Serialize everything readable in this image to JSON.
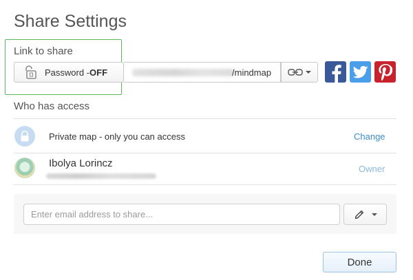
{
  "dialog": {
    "title": "Share Settings"
  },
  "link_section": {
    "label": "Link to share",
    "password_button": {
      "label": "Password - ",
      "state": "OFF"
    },
    "url_suffix": "/mindmap",
    "link_options_icon": "chain-link-icon"
  },
  "social": [
    {
      "name": "facebook",
      "icon": "facebook-icon",
      "color": "#3b5998"
    },
    {
      "name": "twitter",
      "icon": "twitter-icon",
      "color": "#4a9fe8"
    },
    {
      "name": "pinterest",
      "icon": "pinterest-icon",
      "color": "#c8232c"
    }
  ],
  "access_section": {
    "label": "Who has access",
    "rows": [
      {
        "icon": "lock-icon",
        "text": "Private map - only you can access",
        "action": "Change"
      },
      {
        "name": "Ibolya Lorincz",
        "role": "Owner"
      }
    ]
  },
  "invite": {
    "placeholder": "Enter email address to share...",
    "permission_icon": "pencil-icon"
  },
  "footer": {
    "done_label": "Done"
  },
  "colors": {
    "highlight_border": "#5cb85c",
    "link": "#3a8fcc",
    "owner": "#8ab9dd"
  }
}
